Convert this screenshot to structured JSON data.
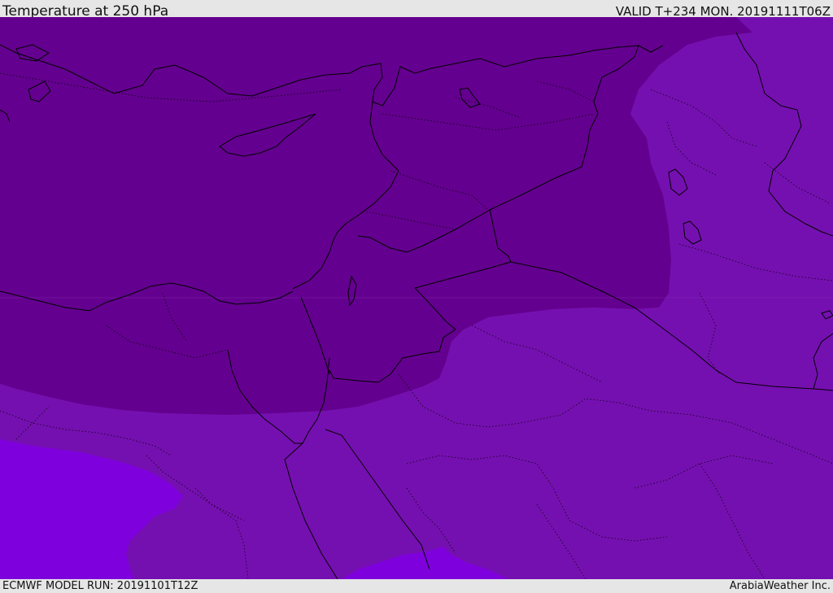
{
  "header": {
    "title": "Temperature at 250 hPa",
    "valid_time": "VALID T+234 MON. 20191111T06Z"
  },
  "footer": {
    "model_run": "ECMWF MODEL RUN: 20191101T12Z",
    "credit": "ArabiaWeather Inc."
  },
  "colors": {
    "zone_warmest": "#64008f",
    "zone_middle": "#7510b0",
    "zone_coldest": "#7e00dc",
    "borders": "#000000",
    "background": "#e6e6e6"
  }
}
